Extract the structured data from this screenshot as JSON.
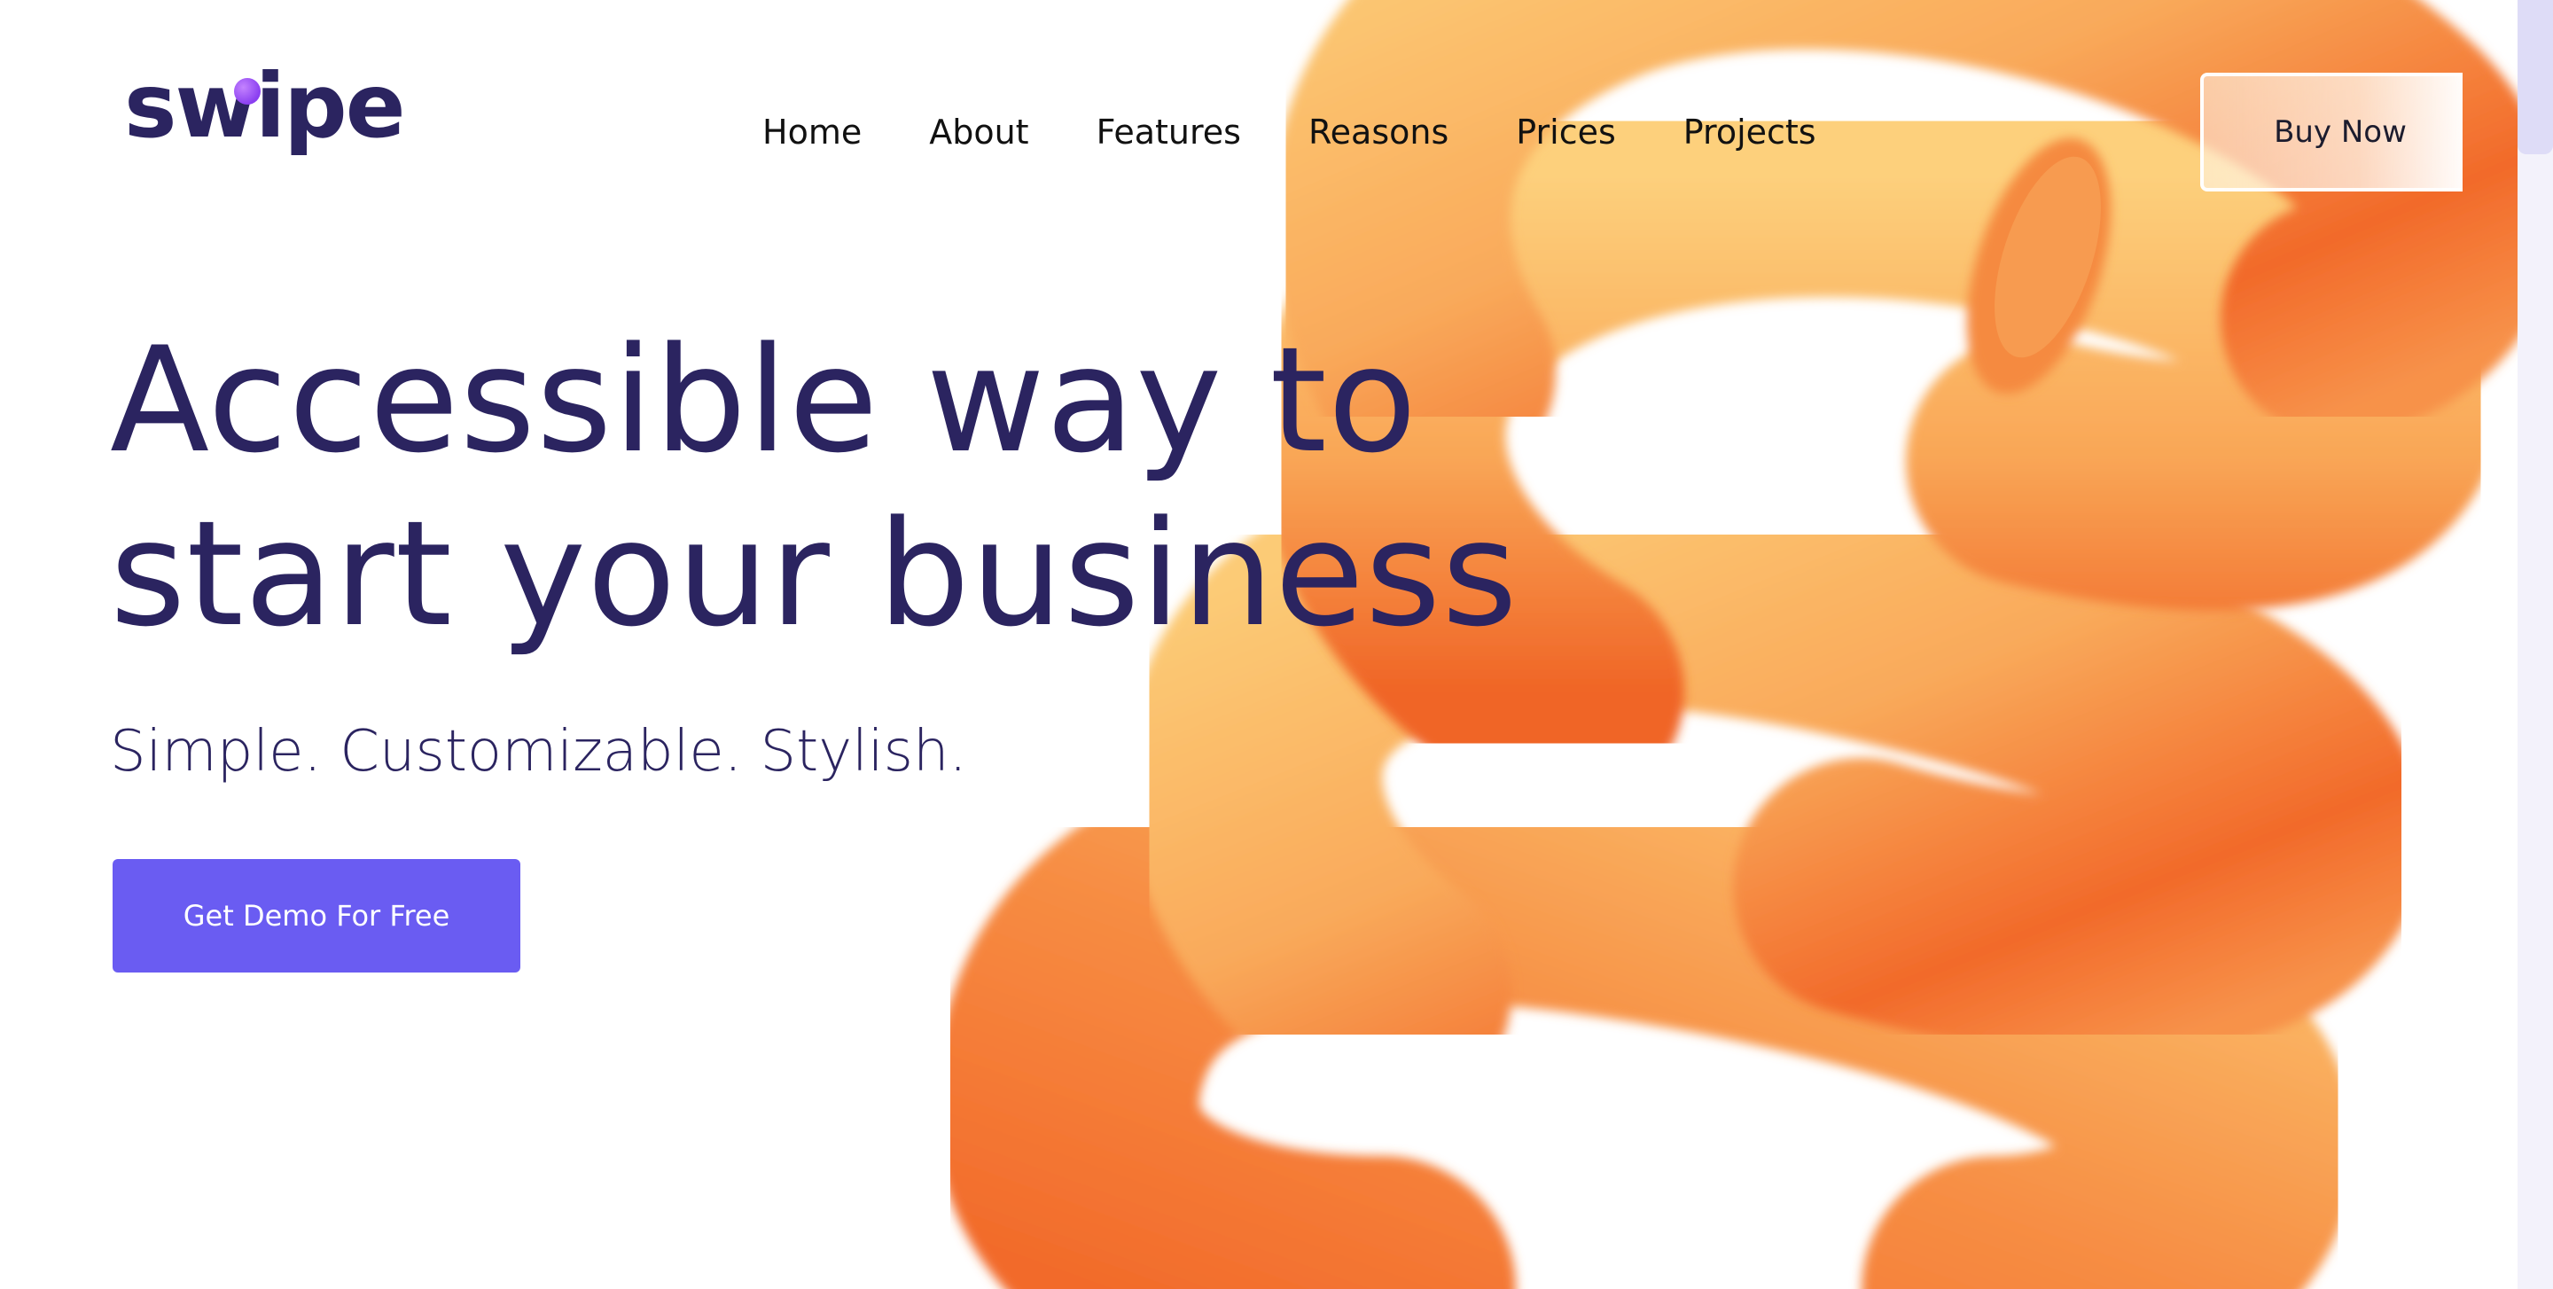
{
  "brand": {
    "logo_text": "swipe",
    "primary_color": "#2b2460",
    "accent_color": "#6a5cf2",
    "logo_dot_color": "#8a3ff0"
  },
  "nav": {
    "items": [
      {
        "label": "Home"
      },
      {
        "label": "About"
      },
      {
        "label": "Features"
      },
      {
        "label": "Reasons"
      },
      {
        "label": "Prices"
      },
      {
        "label": "Projects"
      }
    ],
    "buy_label": "Buy Now"
  },
  "hero": {
    "title_line1": "Accessible way to",
    "title_line2": "start your business",
    "tagline": "Simple. Customizable. Stylish.",
    "cta_label": "Get Demo For Free",
    "illustration": "orange-3d-spiral",
    "illustration_colors": [
      "#f26a2a",
      "#f9a559",
      "#fcc873"
    ]
  }
}
